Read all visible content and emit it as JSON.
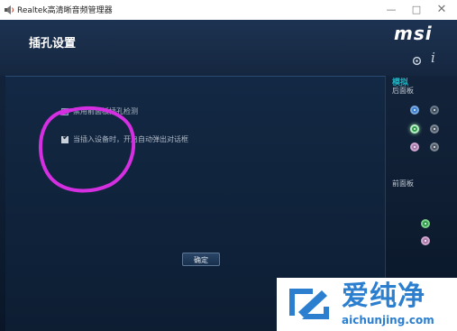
{
  "window": {
    "title": "Realtek高清晰音频管理器",
    "minimize": "—",
    "maximize": "□",
    "close": "✕"
  },
  "header": {
    "title": "插孔设置",
    "logo": "msi",
    "info_glyph": "i"
  },
  "options": [
    {
      "label": "禁用前面板插孔检测",
      "checked": false
    },
    {
      "label": "当插入设备时，开启自动弹出对话框",
      "checked": true
    }
  ],
  "ok_button": "确定",
  "sidebar": {
    "analog": "模拟",
    "back_panel": "后面板",
    "front_panel": "前面板"
  },
  "jacks": {
    "back": [
      "blue",
      "gray",
      "green",
      "gray",
      "pink",
      "gray"
    ],
    "front": [
      "green",
      "pink"
    ]
  },
  "colors": {
    "accent_cyan": "#1fb3c2",
    "highlight_ring": "#d42fe0",
    "watermark_blue": "#2c7fcf"
  },
  "watermark": {
    "brand": "爱纯净",
    "url": "aichunjing.com"
  }
}
